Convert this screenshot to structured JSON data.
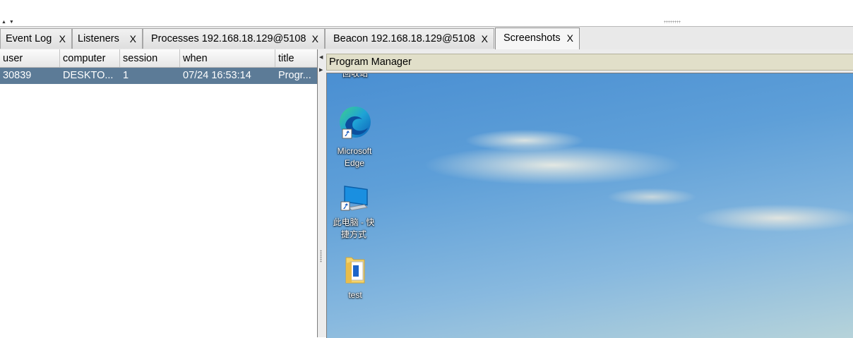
{
  "tabs": [
    {
      "label": "Event Log",
      "close": "X"
    },
    {
      "label": "Listeners",
      "close": "X"
    },
    {
      "label": "Processes 192.168.18.129@5108",
      "close": "X"
    },
    {
      "label": "Beacon 192.168.18.129@5108",
      "close": "X"
    },
    {
      "label": "Screenshots",
      "close": "X",
      "active": true
    }
  ],
  "table": {
    "columns": [
      "user",
      "computer",
      "session",
      "when",
      "title"
    ],
    "rows": [
      [
        "30839",
        "DESKTO...",
        "1",
        "07/24 16:53:14",
        "Progr..."
      ]
    ]
  },
  "screenshot": {
    "window_title": "Program Manager",
    "desktop_icons": [
      {
        "label": "回收站",
        "icon": "recycle-bin-icon"
      },
      {
        "label": "Microsoft Edge",
        "icon": "edge-icon"
      },
      {
        "label": "此电脑 - 快捷方式",
        "icon": "computer-icon"
      },
      {
        "label": "test",
        "icon": "folder-icon"
      }
    ]
  },
  "colors": {
    "selected_row": "#5c7b97",
    "program_bar": "#e1dfc9"
  }
}
